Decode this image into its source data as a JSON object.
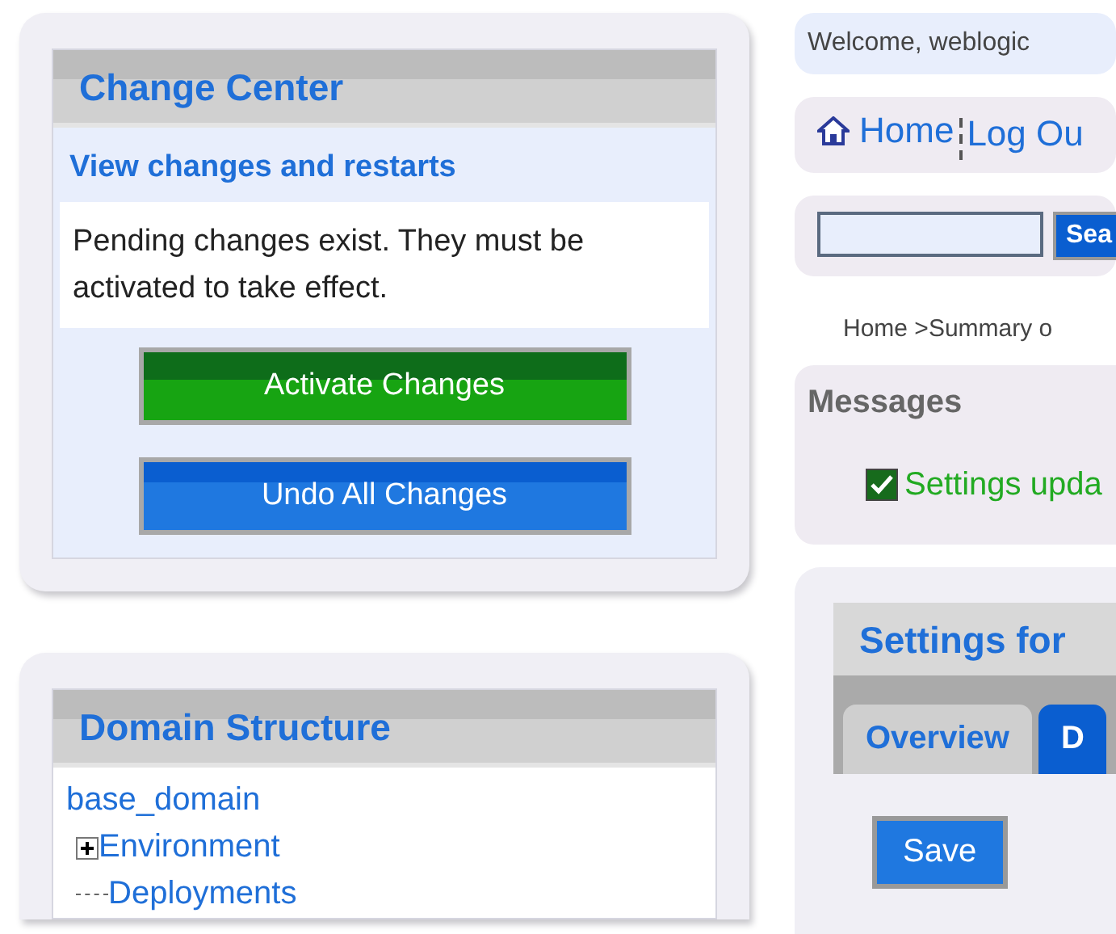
{
  "change_center": {
    "title": "Change Center",
    "link": "View changes and restarts",
    "message": "Pending changes exist. They must be activated to take effect.",
    "buttons": [
      {
        "label": "Activate Changes",
        "kind": "primary"
      },
      {
        "label": "Undo All Changes",
        "kind": "secondary"
      }
    ]
  },
  "domain_structure": {
    "title": "Domain Structure",
    "tree": [
      {
        "label": "base_domain",
        "children": [
          {
            "label": "Environment",
            "expanded": false
          },
          {
            "label": "Deployments"
          }
        ]
      }
    ]
  },
  "header": {
    "welcome": "Welcome, weblogic",
    "nav": [
      {
        "label": "Home"
      },
      {
        "label": "Log Ou"
      }
    ],
    "search_button": "Sea"
  },
  "breadcrumb": "Home >Summary o",
  "messages": {
    "title": "Messages",
    "items": [
      "Settings upda"
    ]
  },
  "settings": {
    "title": "Settings for",
    "tabs": [
      {
        "label": "Overview",
        "selected": false
      },
      {
        "label": "D",
        "selected": true
      }
    ],
    "save_button": "Save"
  }
}
